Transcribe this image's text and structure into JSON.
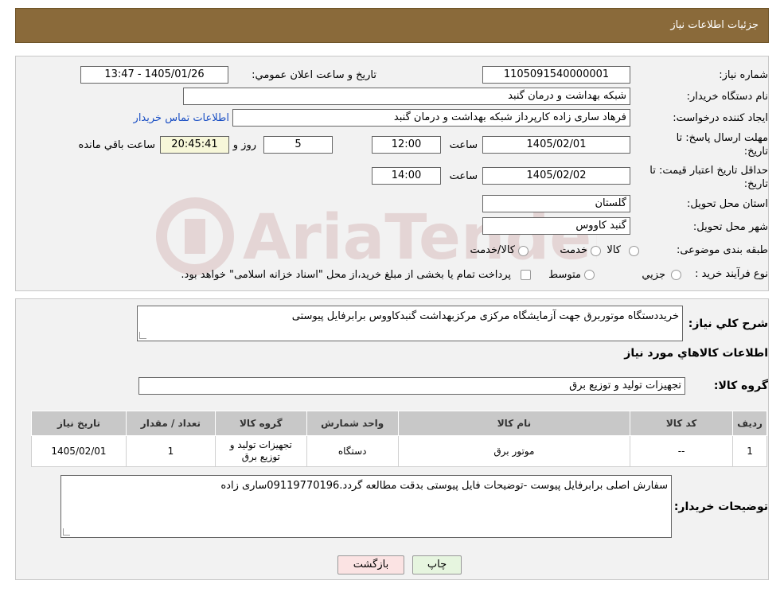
{
  "header": {
    "title": "جزئیات اطلاعات نیاز"
  },
  "form": {
    "need_number": {
      "label": "شماره نیاز:",
      "value": "1105091540000001"
    },
    "announce_datetime": {
      "label": "تاریخ و ساعت اعلان عمومي:",
      "value": "1405/01/26 - 13:47"
    },
    "buyer_org": {
      "label": "نام دستگاه خریدار:",
      "value": "شبکه بهداشت و درمان گنبد"
    },
    "requester": {
      "label": "ایجاد کننده درخواست:",
      "value": "فرهاد ساری زاده کارپرداز شبکه بهداشت و درمان گنبد",
      "contact_link": "اطلاعات تماس خریدار"
    },
    "reply_deadline": {
      "label_line1": "مهلت ارسال پاسخ: تا",
      "label_line2": "تاریخ:",
      "date": "1405/02/01",
      "time_label": "ساعت",
      "time": "12:00",
      "days": "5",
      "days_label": "روز و",
      "remaining": "20:45:41",
      "remaining_label": "ساعت باقي مانده"
    },
    "price_validity": {
      "label_line1": "حداقل تاریخ اعتبار قیمت: تا",
      "label_line2": "تاریخ:",
      "date": "1405/02/02",
      "time_label": "ساعت",
      "time": "14:00"
    },
    "delivery_province": {
      "label": "استان محل تحویل:",
      "value": "گلستان"
    },
    "delivery_city": {
      "label": "شهر محل تحویل:",
      "value": "گنبد کاووس"
    },
    "category": {
      "label": "طبقه بندی موضوعی:",
      "options": [
        "کالا",
        "خدمت",
        "کالا/خدمت"
      ]
    },
    "purchase_type": {
      "label": "نوع فرآیند خرید :",
      "options": [
        "جزيي",
        "متوسط"
      ],
      "note": "پرداخت تمام یا بخشی از مبلغ خرید،از محل \"اسناد خزانه اسلامی\" خواهد بود."
    }
  },
  "description": {
    "label": "شرح کلي نياز:",
    "value": "خریددستگاه موتوربرق جهت آزمایشگاه مرکزی مرکزبهداشت گنبدکاووس برابرفایل پیوستی"
  },
  "goods_section": {
    "title": "اطلاعات کالاهاي مورد نياز"
  },
  "goods_group": {
    "label": "گروه کالا:",
    "value": "تجهیزات تولید و توزیع برق"
  },
  "table": {
    "headers": [
      "رديف",
      "کد کالا",
      "نام کالا",
      "واحد شمارش",
      "گروه کالا",
      "تعداد / مقدار",
      "تاريخ نياز"
    ],
    "rows": [
      [
        "1",
        "--",
        "موتور برق",
        "دستگاه",
        "تجهیزات تولید و توزیع برق",
        "1",
        "1405/02/01"
      ]
    ]
  },
  "buyer_notes": {
    "label": "توضیحات خریدار:",
    "value": "سفارش اصلی برابرفایل پیوست -توضیحات فایل پیوستی بدقت مطالعه گردد.09119770196ساری زاده"
  },
  "buttons": {
    "print": "چاپ",
    "back": "بازگشت"
  },
  "watermark": "AriaTender.neT"
}
